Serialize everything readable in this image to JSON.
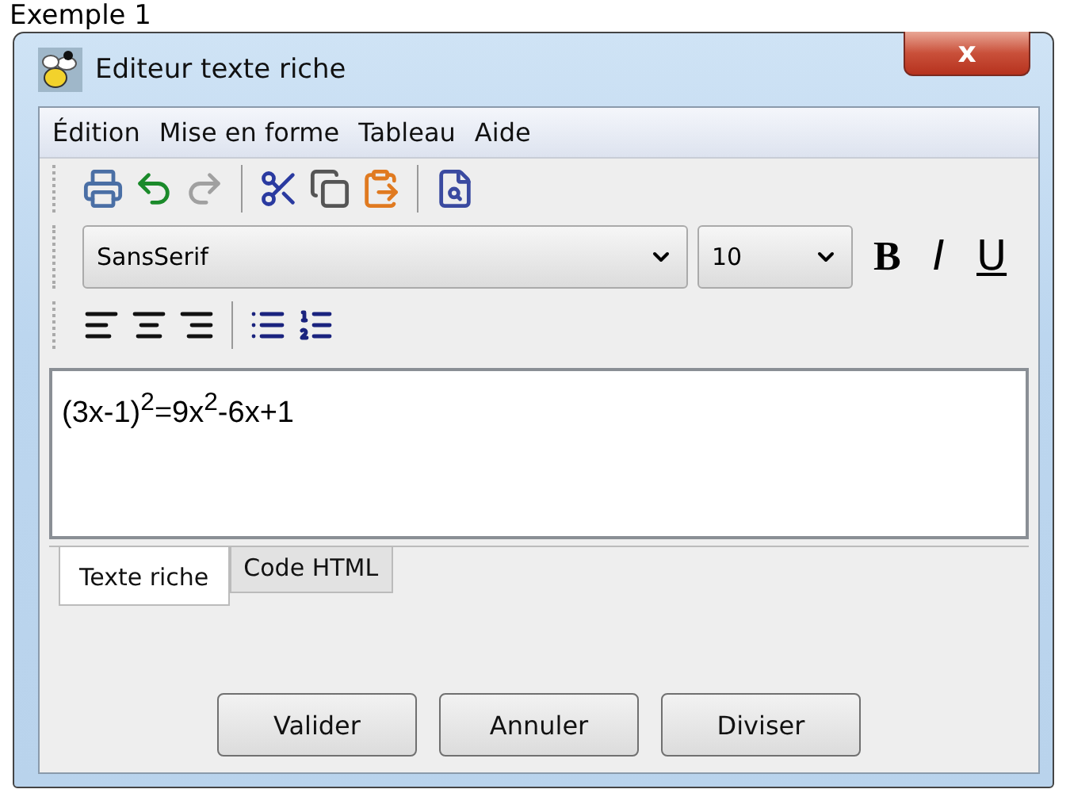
{
  "page_heading": "Exemple 1",
  "window": {
    "title": "Editeur texte riche",
    "close": "x"
  },
  "menu": [
    "Édition",
    "Mise en forme",
    "Tableau",
    "Aide"
  ],
  "toolbar_edit": [
    [
      {
        "kind": "printer",
        "disabled": false
      },
      {
        "kind": "undo",
        "disabled": false
      },
      {
        "kind": "redo",
        "disabled": true
      }
    ],
    [
      {
        "kind": "cut",
        "disabled": false
      },
      {
        "kind": "copy",
        "disabled": false
      },
      {
        "kind": "paste",
        "disabled": false
      }
    ],
    [
      {
        "kind": "preview",
        "disabled": false
      }
    ]
  ],
  "font": {
    "family": "SansSerif",
    "size": "10"
  },
  "style_buttons": [
    {
      "kind": "bold",
      "label": "B"
    },
    {
      "kind": "italic",
      "label": "I"
    },
    {
      "kind": "underline",
      "label": "U"
    }
  ],
  "toolbar_paragraph": [
    [
      {
        "kind": "align-left"
      },
      {
        "kind": "align-center"
      },
      {
        "kind": "align-right"
      }
    ],
    [
      {
        "kind": "bullet-list"
      },
      {
        "kind": "numbered-list"
      }
    ]
  ],
  "editor_text": "(3x-1)$^{2}$=9x$^{2}$-6x+1",
  "tabs": [
    {
      "label": "Texte riche",
      "selected": true
    },
    {
      "label": "Code HTML",
      "selected": false
    }
  ],
  "buttons": [
    "Valider",
    "Annuler",
    "Diviser"
  ]
}
